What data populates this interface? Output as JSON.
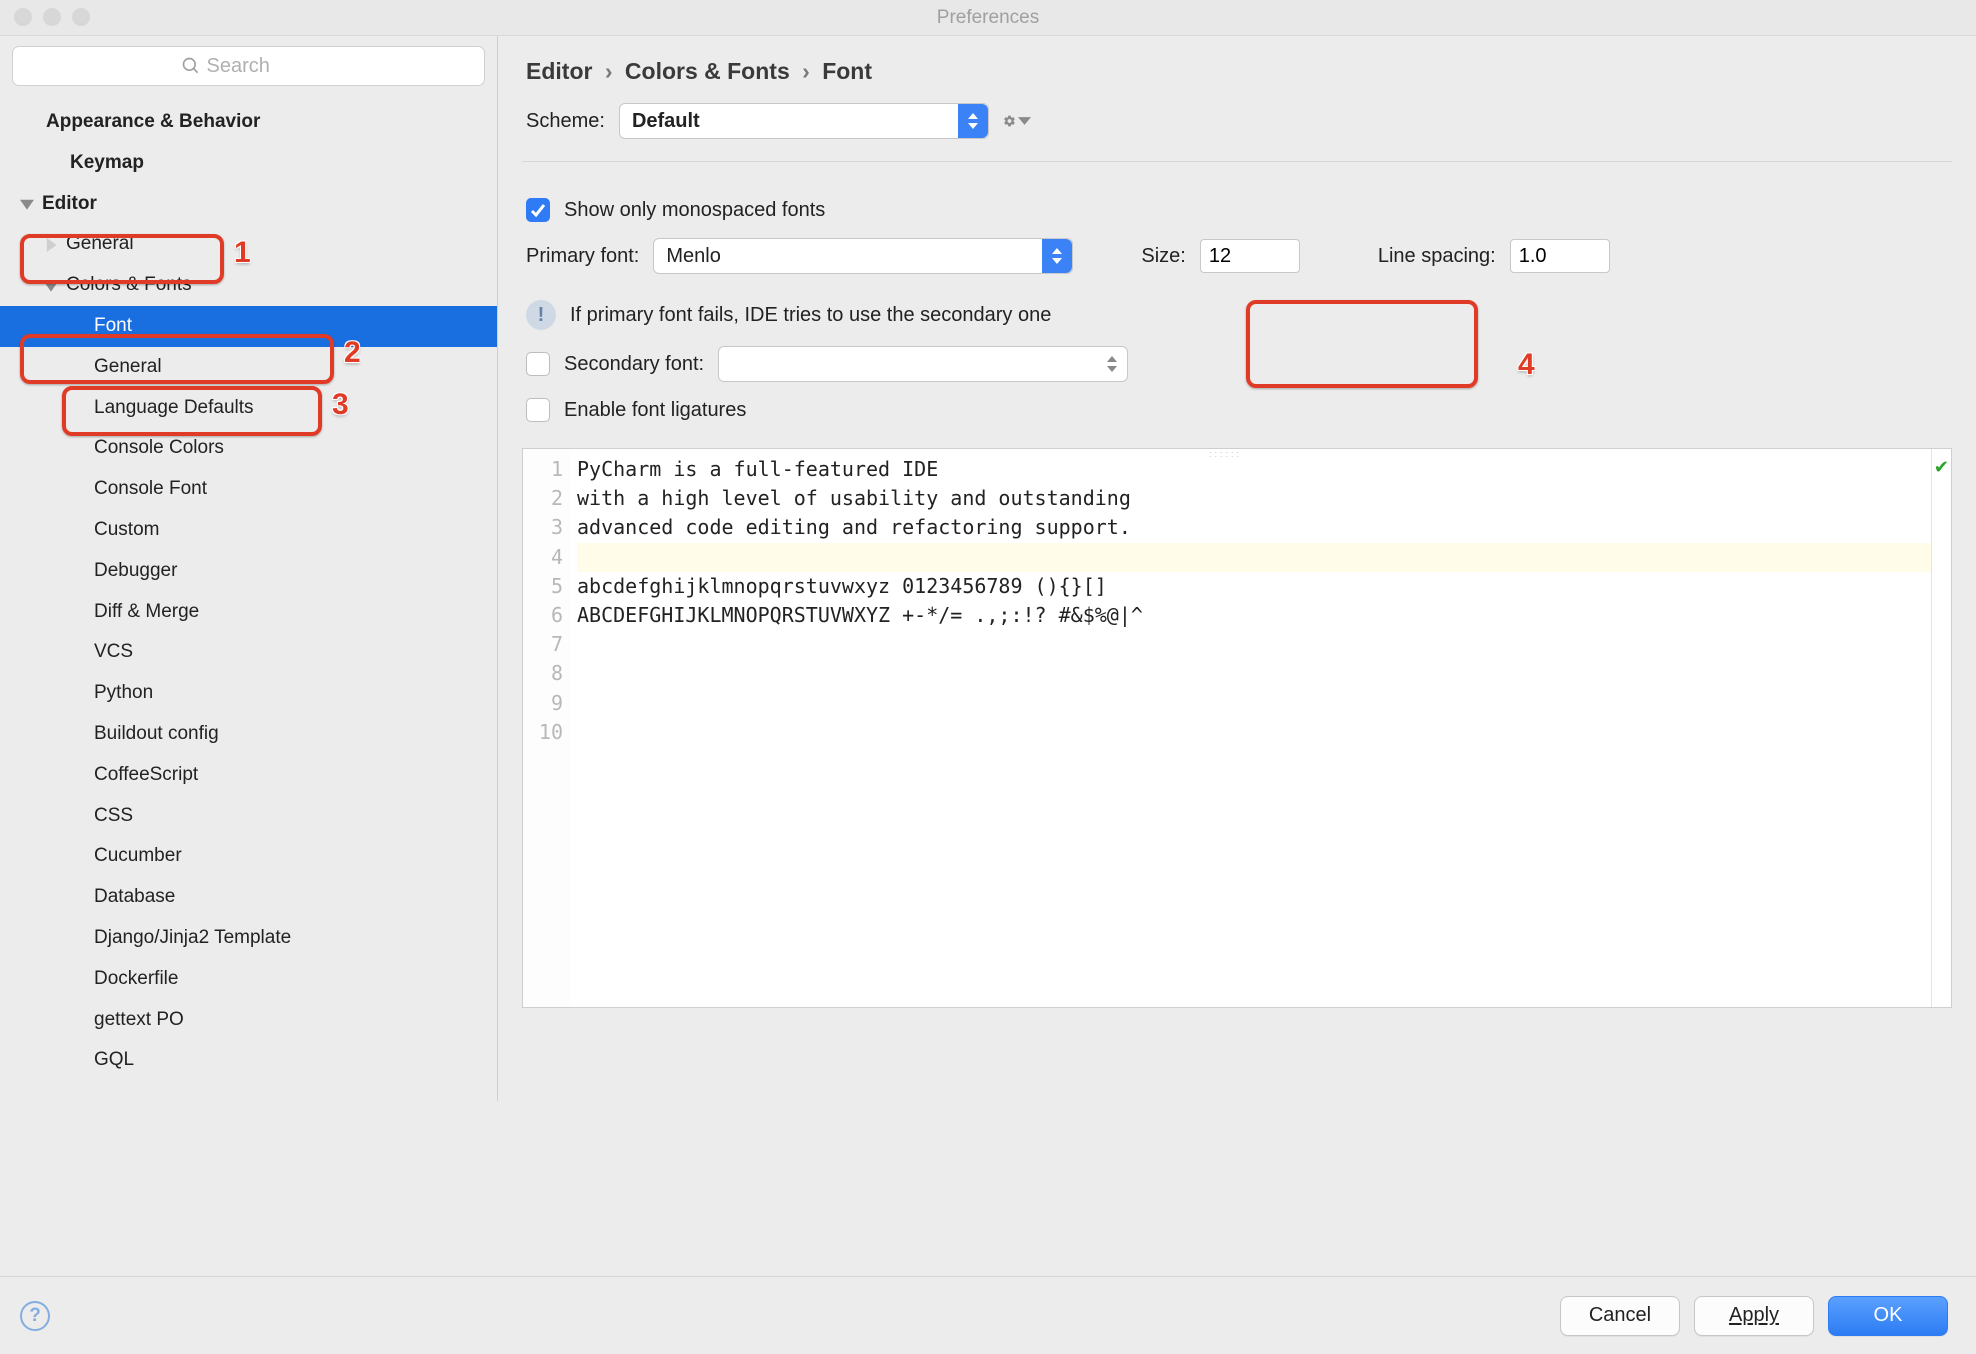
{
  "window": {
    "title": "Preferences"
  },
  "search": {
    "placeholder": "Search"
  },
  "sidebar": {
    "items": [
      {
        "label": "Appearance & Behavior",
        "level": 1,
        "bold": true
      },
      {
        "label": "Keymap",
        "level": 2,
        "bold": true
      },
      {
        "label": "Editor",
        "level": 1,
        "bold": true,
        "expandable": true,
        "expanded": true
      },
      {
        "label": "General",
        "level": 2,
        "expandable": true,
        "expanded": false
      },
      {
        "label": "Colors & Fonts",
        "level": 2,
        "expandable": true,
        "expanded": true
      },
      {
        "label": "Font",
        "level": 3,
        "selected": true
      },
      {
        "label": "General",
        "level": 3
      },
      {
        "label": "Language Defaults",
        "level": 3
      },
      {
        "label": "Console Colors",
        "level": 3
      },
      {
        "label": "Console Font",
        "level": 3
      },
      {
        "label": "Custom",
        "level": 3
      },
      {
        "label": "Debugger",
        "level": 3
      },
      {
        "label": "Diff & Merge",
        "level": 3
      },
      {
        "label": "VCS",
        "level": 3
      },
      {
        "label": "Python",
        "level": 3
      },
      {
        "label": "Buildout config",
        "level": 3
      },
      {
        "label": "CoffeeScript",
        "level": 3
      },
      {
        "label": "CSS",
        "level": 3
      },
      {
        "label": "Cucumber",
        "level": 3
      },
      {
        "label": "Database",
        "level": 3
      },
      {
        "label": "Django/Jinja2 Template",
        "level": 3
      },
      {
        "label": "Dockerfile",
        "level": 3
      },
      {
        "label": "gettext PO",
        "level": 3
      },
      {
        "label": "GQL",
        "level": 3
      }
    ]
  },
  "breadcrumb": {
    "a": "Editor",
    "b": "Colors & Fonts",
    "c": "Font",
    "sep": "›"
  },
  "scheme": {
    "label": "Scheme:",
    "value": "Default"
  },
  "fonts": {
    "monospaced_label": "Show only monospaced fonts",
    "monospaced_checked": true,
    "primary_label": "Primary font:",
    "primary_value": "Menlo",
    "size_label": "Size:",
    "size_value": "12",
    "spacing_label": "Line spacing:",
    "spacing_value": "1.0",
    "secondary_hint": "If primary font fails, IDE tries to use the secondary one",
    "secondary_label": "Secondary font:",
    "secondary_value": "",
    "ligatures_label": "Enable font ligatures",
    "ligatures_checked": false
  },
  "preview": {
    "lines": [
      "PyCharm is a full-featured IDE",
      "with a high level of usability and outstanding",
      "advanced code editing and refactoring support.",
      "",
      "abcdefghijklmnopqrstuvwxyz 0123456789 (){}[]",
      "ABCDEFGHIJKLMNOPQRSTUVWXYZ +-*/= .,;:!? #&$%@|^",
      "",
      "",
      "",
      ""
    ],
    "line_count": 10
  },
  "footer": {
    "cancel": "Cancel",
    "apply": "Apply",
    "ok": "OK"
  },
  "annotations": {
    "a1": "1",
    "a2": "2",
    "a3": "3",
    "a4": "4"
  }
}
